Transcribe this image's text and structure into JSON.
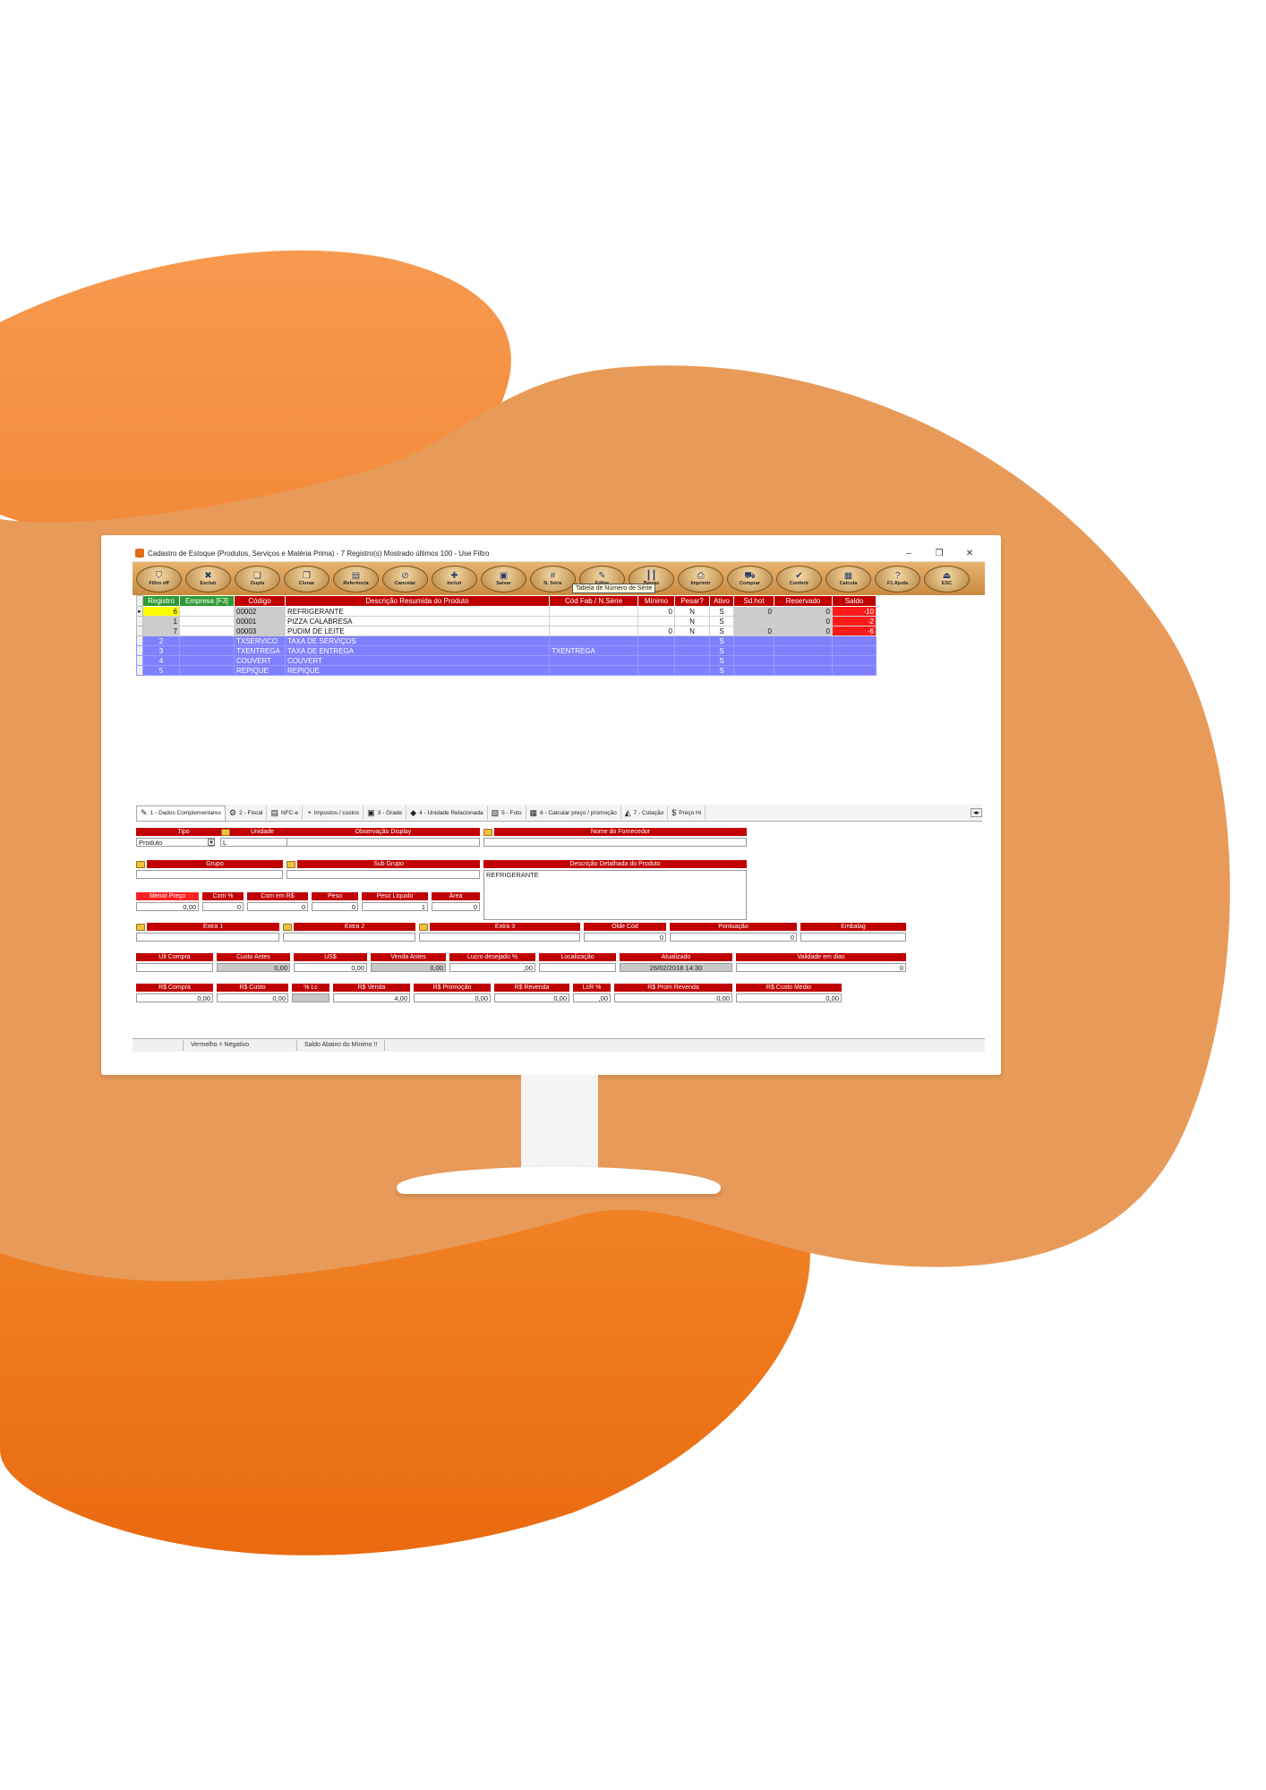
{
  "window": {
    "title": "Cadastro de Estoque (Produtos, Serviços e Matéria Prima) - 7 Registro(s) Mostrado últimos 100 - Use Filtro",
    "min": "–",
    "max": "❐",
    "close": "✕"
  },
  "toolbar": {
    "buttons": [
      {
        "label": "Filtro off",
        "icon": "filter-icon",
        "glyph": "⛉"
      },
      {
        "label": "Excluir",
        "icon": "delete-icon",
        "glyph": "✖"
      },
      {
        "label": "Dupla",
        "icon": "duplicate-icon",
        "glyph": "❏"
      },
      {
        "label": "Clonar",
        "icon": "clone-icon",
        "glyph": "❐"
      },
      {
        "label": "Referência",
        "icon": "reference-icon",
        "glyph": "▤"
      },
      {
        "label": "Cancelar",
        "icon": "cancel-icon",
        "glyph": "⊘"
      },
      {
        "label": "Incluir",
        "icon": "add-icon",
        "glyph": "✚"
      },
      {
        "label": "Salvar",
        "icon": "save-icon",
        "glyph": "▣"
      },
      {
        "label": "N. Série",
        "icon": "serial-icon",
        "glyph": "#"
      },
      {
        "label": "Editar",
        "icon": "edit-icon",
        "glyph": "✎"
      },
      {
        "label": "Barras",
        "icon": "barcode-icon",
        "glyph": "┃┃"
      },
      {
        "label": "Imprimir",
        "icon": "printer-icon",
        "glyph": "⎙"
      },
      {
        "label": "Comprar",
        "icon": "cart-icon",
        "glyph": "⛟"
      },
      {
        "label": "Conferir",
        "icon": "check-icon",
        "glyph": "✔"
      },
      {
        "label": "Calcula",
        "icon": "calculator-icon",
        "glyph": "▦"
      },
      {
        "label": "F1 Ajuda",
        "icon": "help-icon",
        "glyph": "?"
      },
      {
        "label": "ESC",
        "icon": "exit-icon",
        "glyph": "⏏"
      }
    ],
    "tooltip": "Tabela de Número de Série"
  },
  "grid": {
    "columns": [
      "Registro",
      "Empresa [F3]",
      "Código",
      "Descrição Resumida do Produto",
      "Cód Fab / N.Série",
      "Mínimo",
      "Pesar?",
      "Ativo",
      "Sd.hot",
      "Reservado",
      "Saldo"
    ],
    "rows": [
      {
        "registro": "6",
        "empresa": "",
        "codigo": "00002",
        "descricao": "REFRIGERANTE",
        "codfab": "",
        "minimo": "0",
        "pesar": "N",
        "ativo": "S",
        "sdhot": "0",
        "reservado": "0",
        "saldo": "-10",
        "type": "product",
        "selected": true
      },
      {
        "registro": "1",
        "empresa": "",
        "codigo": "00001",
        "descricao": "PIZZA CALABRESA",
        "codfab": "",
        "minimo": "",
        "pesar": "N",
        "ativo": "S",
        "sdhot": "",
        "reservado": "0",
        "saldo": "-2",
        "type": "product",
        "selected": false
      },
      {
        "registro": "7",
        "empresa": "",
        "codigo": "00003",
        "descricao": "PUDIM DE LEITE",
        "codfab": "",
        "minimo": "0",
        "pesar": "N",
        "ativo": "S",
        "sdhot": "0",
        "reservado": "0",
        "saldo": "-6",
        "type": "product",
        "selected": false
      },
      {
        "registro": "2",
        "empresa": "",
        "codigo": "TXSERVICO",
        "descricao": "TAXA DE SERVIÇOS",
        "codfab": "",
        "minimo": "",
        "pesar": "",
        "ativo": "S",
        "sdhot": "",
        "reservado": "",
        "saldo": "",
        "type": "service",
        "selected": false
      },
      {
        "registro": "3",
        "empresa": "",
        "codigo": "TXENTREGA",
        "descricao": "TAXA DE ENTREGA",
        "codfab": "TXENTREGA",
        "minimo": "",
        "pesar": "",
        "ativo": "S",
        "sdhot": "",
        "reservado": "",
        "saldo": "",
        "type": "service",
        "selected": false
      },
      {
        "registro": "4",
        "empresa": "",
        "codigo": "COUVERT",
        "descricao": "COUVERT",
        "codfab": "",
        "minimo": "",
        "pesar": "",
        "ativo": "S",
        "sdhot": "",
        "reservado": "",
        "saldo": "",
        "type": "service",
        "selected": false
      },
      {
        "registro": "5",
        "empresa": "",
        "codigo": "REPIQUE",
        "descricao": "REPIQUE",
        "codfab": "",
        "minimo": "",
        "pesar": "",
        "ativo": "S",
        "sdhot": "",
        "reservado": "",
        "saldo": "",
        "type": "service",
        "selected": false
      }
    ]
  },
  "tabs": [
    {
      "label": "1 - Dados Complementares",
      "icon": "edit-icon",
      "glyph": "✎",
      "active": true
    },
    {
      "label": "2 - Fiscal",
      "icon": "gear-icon",
      "glyph": "⚙",
      "active": false
    },
    {
      "label": "NFC-e",
      "icon": "document-icon",
      "glyph": "▤",
      "active": false
    },
    {
      "label": "Impostos / custos",
      "icon": "tax-icon",
      "glyph": "◔",
      "active": false
    },
    {
      "label": "3 - Grade",
      "icon": "shirt-icon",
      "glyph": "▣",
      "active": false
    },
    {
      "label": "4 - Unidade Relacionada",
      "icon": "units-icon",
      "glyph": "◆",
      "active": false
    },
    {
      "label": "5 - Foto",
      "icon": "photo-icon",
      "glyph": "▨",
      "active": false
    },
    {
      "label": "6 - Calcular preço / promoção",
      "icon": "calculator-icon",
      "glyph": "▦",
      "active": false
    },
    {
      "label": "7 - Cotação",
      "icon": "quote-icon",
      "glyph": "◭",
      "active": false
    },
    {
      "label": "Preço Hi",
      "icon": "price-icon",
      "glyph": "$",
      "active": false
    }
  ],
  "tab_scroll": "◂▸",
  "form": {
    "tipo": {
      "label": "Tipo",
      "value": "Produto",
      "arrow": "▼"
    },
    "unidade": {
      "label": "Unidade",
      "value": "L"
    },
    "obs_display": {
      "label": "Observação Display",
      "value": ""
    },
    "fornecedor": {
      "label": "Nome do Fornecedor",
      "value": ""
    },
    "grupo": {
      "label": "Grupo",
      "value": ""
    },
    "subgrupo": {
      "label": "Sub Grupo",
      "value": ""
    },
    "desc_detalhada": {
      "label": "Descrição Detalhada do Produto",
      "value": "REFRIGERANTE"
    },
    "menor_preco": {
      "label": "Menor Preço",
      "value": "0,00"
    },
    "com_pct": {
      "label": "Com %",
      "value": "0"
    },
    "com_rs": {
      "label": "Com em R$",
      "value": "0"
    },
    "peso": {
      "label": "Peso",
      "value": "0"
    },
    "peso_liquido": {
      "label": "Peso Líquido",
      "value": "1"
    },
    "area": {
      "label": "Área",
      "value": "0"
    },
    "extra1": {
      "label": "Extra 1",
      "value": ""
    },
    "extra2": {
      "label": "Extra 2",
      "value": ""
    },
    "extra3": {
      "label": "Extra 3",
      "value": ""
    },
    "olde_cod": {
      "label": "Olde Cód",
      "value": "0"
    },
    "pontuacao": {
      "label": "Pontuação",
      "value": "0"
    },
    "embalag": {
      "label": "Embalag",
      "value": ""
    },
    "ult_compra": {
      "label": "Ult Compra",
      "value": ""
    },
    "custo_antes": {
      "label": "Custo Antes",
      "value": "0,00"
    },
    "uss": {
      "label": "US$",
      "value": "0,00"
    },
    "venda_antes": {
      "label": "Venda Antes",
      "value": "0,00"
    },
    "lucro_desejado": {
      "label": "Lucro desejado %",
      "value": ",00"
    },
    "localizacao": {
      "label": "Localização",
      "value": ""
    },
    "atualizado": {
      "label": "Atualizado",
      "value": "26/02/2018 14:30"
    },
    "validade": {
      "label": "Validade em dias",
      "value": "0"
    },
    "rs_compra": {
      "label": "R$ Compra",
      "value": "0,00"
    },
    "rs_custo": {
      "label": "R$ Custo",
      "value": "0,00"
    },
    "pct_lc": {
      "label": "% Lc",
      "value": ""
    },
    "rs_venda": {
      "label": "R$ Venda",
      "value": "4,00"
    },
    "rs_promocao": {
      "label": "R$ Promoção",
      "value": "0,00"
    },
    "rs_revenda": {
      "label": "R$ Revenda",
      "value": "0,00"
    },
    "lcr_pct": {
      "label": "LcR %",
      "value": ",00"
    },
    "rs_prom_revenda": {
      "label": "R$ Prom Revenda",
      "value": "0,00"
    },
    "rs_custo_medio": {
      "label": "R$ Custo Médio",
      "value": "0,00"
    }
  },
  "statusbar": {
    "cell1": "",
    "cell2": "Vermelho = Negativo",
    "cell3": "Saldo Abaixo do Mínimo !!"
  },
  "colors": {
    "orange_top": "#f7954a",
    "orange_mid": "#e89a58",
    "orange_bottom": "#ef7418",
    "header_red": "#c00000",
    "service_row": "#8080ff",
    "selected_row": "#ffff00",
    "negative": "#ff1a1a"
  }
}
